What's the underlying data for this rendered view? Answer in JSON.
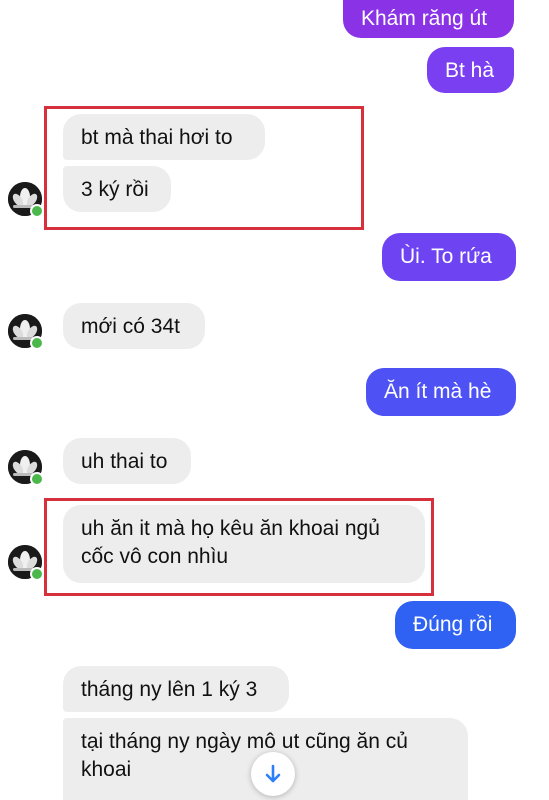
{
  "messages": {
    "m1": "Khám răng út",
    "m2": "Bt hà",
    "m3": "bt mà thai hơi to",
    "m4": "3 ký rồi",
    "m5": "Ùi. To rứa",
    "m6": "mới có 34t",
    "m7": "Ăn ít mà hè",
    "m8": "uh thai to",
    "m9": "uh ăn it mà họ kêu ăn khoai ngủ cốc vô con nhìu",
    "m10": "Đúng rồi",
    "m11": "tháng ny lên 1 ký 3",
    "m12": "tại tháng ny ngày mô ut cũng ăn củ khoai"
  },
  "colors": {
    "incoming_bg": "#ededed",
    "outgoing_purple": "#7b3fe4",
    "outgoing_blue": "#3a5cf0",
    "highlight": "#d6303c",
    "online": "#4cb84c"
  },
  "icons": {
    "avatar": "lotus-avatar",
    "online": "online-dot",
    "scroll": "arrow-down-icon"
  }
}
